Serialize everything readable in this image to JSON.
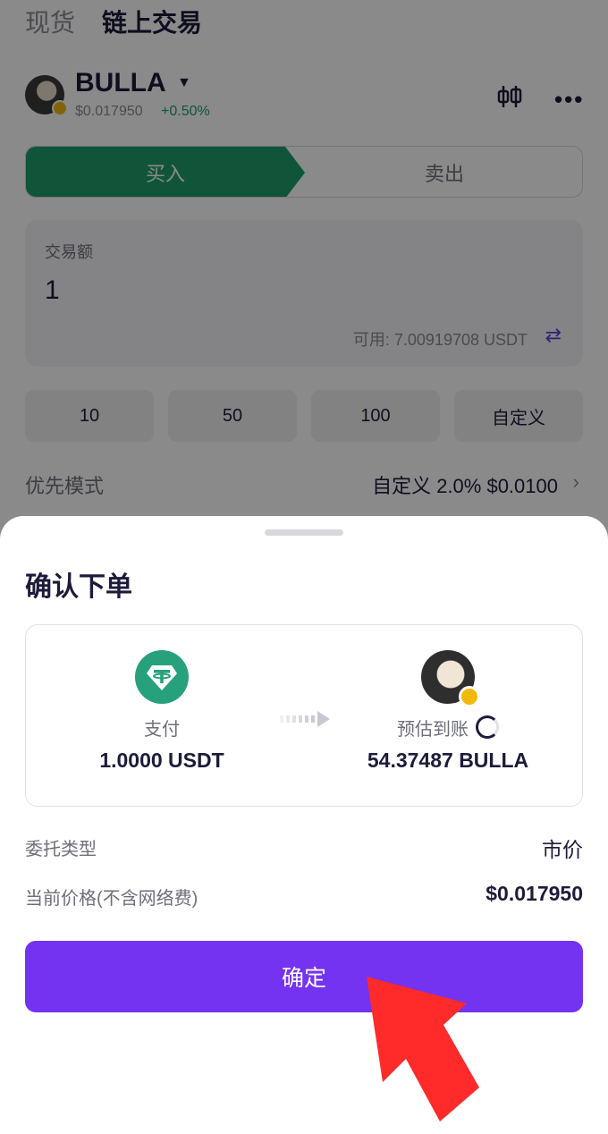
{
  "top_tabs": {
    "spot": "现货",
    "onchain": "链上交易"
  },
  "coin": {
    "name": "BULLA",
    "price": "$0.017950",
    "change": "+0.50%"
  },
  "trade_tabs": {
    "buy": "买入",
    "sell": "卖出"
  },
  "amount": {
    "label": "交易额",
    "value": "1",
    "available": "可用: 7.00919708 USDT"
  },
  "quick_amounts": [
    "10",
    "50",
    "100",
    "自定义"
  ],
  "priority": {
    "label": "优先模式",
    "value": "自定义 2.0% $0.0100"
  },
  "sheet": {
    "title": "确认下单",
    "pay": {
      "label": "支付",
      "value": "1.0000 USDT",
      "icon": "usdt-icon"
    },
    "receive": {
      "label": "预估到账",
      "value": "54.37487 BULLA",
      "icon": "bulla-token-icon"
    },
    "order_type": {
      "label": "委托类型",
      "value": "市价"
    },
    "current_price": {
      "label": "当前价格(不含网络费)",
      "value": "$0.017950"
    },
    "confirm_label": "确定"
  },
  "colors": {
    "buy_green": "#1e9e6a",
    "confirm_purple": "#7433f0",
    "usdt_green": "#26a17b",
    "hint_arrow_red": "#ff2a2a"
  }
}
